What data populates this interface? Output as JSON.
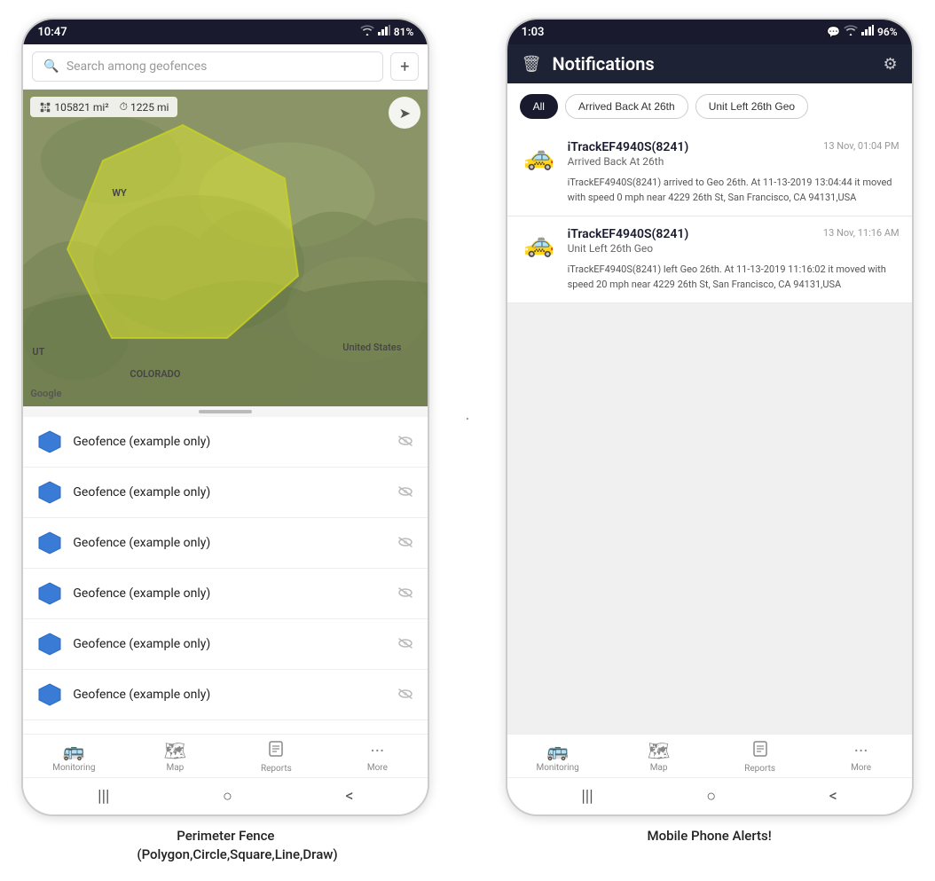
{
  "left_phone": {
    "status_bar": {
      "time": "10:47",
      "wifi": "WiFi",
      "signal": "signal",
      "battery": "81%"
    },
    "search": {
      "placeholder": "Search among geofences"
    },
    "map": {
      "area_label": "105821 mi²",
      "distance_label": "1225 mi",
      "label_wy": "WY",
      "label_us": "United States",
      "label_co": "COLORADO",
      "label_ut": "UT",
      "google": "Google"
    },
    "geofences": [
      {
        "name": "Geofence (example only)"
      },
      {
        "name": "Geofence (example only)"
      },
      {
        "name": "Geofence (example only)"
      },
      {
        "name": "Geofence (example only)"
      },
      {
        "name": "Geofence (example only)"
      },
      {
        "name": "Geofence (example only)"
      }
    ],
    "nav": {
      "items": [
        {
          "label": "Monitoring",
          "icon": "🚌"
        },
        {
          "label": "Map",
          "icon": "🗺"
        },
        {
          "label": "Reports",
          "icon": "📊"
        },
        {
          "label": "More",
          "icon": "···"
        }
      ]
    },
    "sys_nav": {
      "menu": "|||",
      "home": "○",
      "back": "<"
    }
  },
  "right_phone": {
    "status_bar": {
      "time": "1:03",
      "chat": "💬",
      "wifi": "WiFi",
      "signal": "signal",
      "battery": "96%"
    },
    "header": {
      "title": "Notifications",
      "delete_icon": "🗑",
      "settings_icon": "⚙"
    },
    "filters": {
      "all": "All",
      "arrived": "Arrived Back At 26th",
      "unit_left": "Unit Left 26th Geo",
      "active": "all"
    },
    "notifications": [
      {
        "device": "iTrackEF4940S(8241)",
        "timestamp": "13 Nov, 01:04 PM",
        "event": "Arrived Back At 26th",
        "detail": "iTrackEF4940S(8241) arrived to Geo 26th.    At 11-13-2019 13:04:44 it moved with speed 0 mph near 4229 26th St, San Francisco, CA 94131,USA"
      },
      {
        "device": "iTrackEF4940S(8241)",
        "timestamp": "13 Nov, 11:16 AM",
        "event": "Unit Left 26th Geo",
        "detail": "iTrackEF4940S(8241) left Geo 26th.    At 11-13-2019 11:16:02 it moved with speed 20 mph near 4229 26th St, San Francisco, CA 94131,USA"
      }
    ],
    "nav": {
      "items": [
        {
          "label": "Monitoring",
          "icon": "🚌"
        },
        {
          "label": "Map",
          "icon": "🗺"
        },
        {
          "label": "Reports",
          "icon": "📊"
        },
        {
          "label": "More",
          "icon": "···"
        }
      ]
    },
    "sys_nav": {
      "menu": "|||",
      "home": "○",
      "back": "<"
    }
  },
  "captions": {
    "left": "Perimeter Fence\n(Polygon,Circle,Square,Line,Draw)",
    "right": "Mobile Phone Alerts!"
  }
}
